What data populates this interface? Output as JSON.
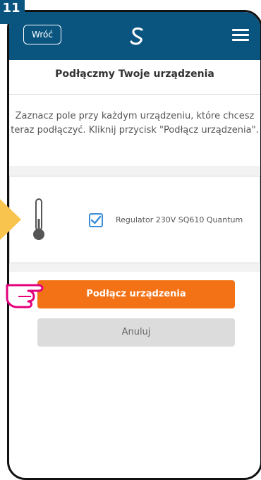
{
  "step_number": "11",
  "header": {
    "back_label": "Wróć",
    "logo_icon": "s-logo-icon",
    "menu_icon": "hamburger-menu-icon"
  },
  "page_title": "Podłączmy Twoje urządzenia",
  "instructions": "Zaznacz pole przy każdym urządzeniu, które chcesz teraz podłączyć. Kliknij przycisk \"Podłącz urządzenia\".",
  "devices": [
    {
      "icon": "thermometer-icon",
      "checked": true,
      "name": "Regulator 230V SQ610 Quantum"
    }
  ],
  "buttons": {
    "connect_label": "Podłącz urządzenia",
    "cancel_label": "Anuluj"
  },
  "colors": {
    "header_bg": "#0a5580",
    "accent_orange": "#f47216",
    "checkbox_blue": "#3b8fd9",
    "arrow_yellow": "#f9c44e",
    "hand_pink": "#e4007c"
  }
}
